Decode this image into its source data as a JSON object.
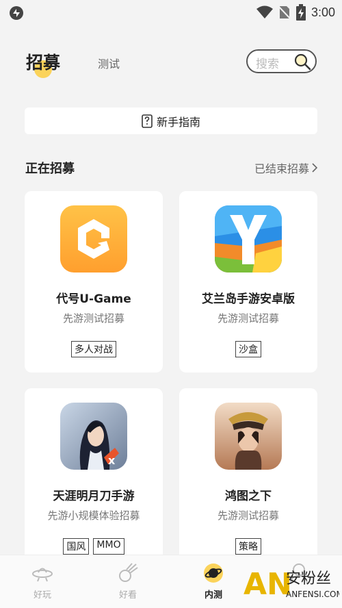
{
  "status_bar": {
    "time": "3:00",
    "icons": [
      "app-icon",
      "wifi-icon",
      "no-sim-icon",
      "battery-charging-icon"
    ]
  },
  "header": {
    "tabs": [
      {
        "label": "招募",
        "active": true
      },
      {
        "label": "测试",
        "active": false
      }
    ],
    "search": {
      "placeholder": "搜索"
    }
  },
  "guide": {
    "label": "新手指南",
    "icon": "question-doc-icon"
  },
  "section": {
    "title": "正在招募",
    "ended_link": "已结束招募"
  },
  "cards": [
    {
      "name": "代号U-Game",
      "subtitle": "先游测试招募",
      "tags": [
        "多人对战"
      ],
      "icon": "u-game-icon"
    },
    {
      "name": "艾兰岛手游安卓版",
      "subtitle": "先游测试招募",
      "tags": [
        "沙盒"
      ],
      "icon": "ylands-icon"
    },
    {
      "name": "天涯明月刀手游",
      "subtitle": "先游小规模体验招募",
      "tags": [
        "国风",
        "MMO"
      ],
      "icon": "tianya-icon"
    },
    {
      "name": "鸿图之下",
      "subtitle": "先游测试招募",
      "tags": [
        "策略"
      ],
      "icon": "hongtu-icon"
    }
  ],
  "bottom_nav": [
    {
      "label": "好玩",
      "icon": "ufo-icon",
      "active": false
    },
    {
      "label": "好看",
      "icon": "comet-icon",
      "active": false
    },
    {
      "label": "内测",
      "icon": "planet-icon",
      "active": true
    },
    {
      "label": "",
      "icon": "profile-icon",
      "active": false
    }
  ],
  "watermark": {
    "brand": "安粉丝",
    "url": "ANFENSI.COM",
    "letters": "AN"
  },
  "colors": {
    "accent": "#fbd35b",
    "background": "#f3f3f3",
    "card": "#ffffff"
  }
}
